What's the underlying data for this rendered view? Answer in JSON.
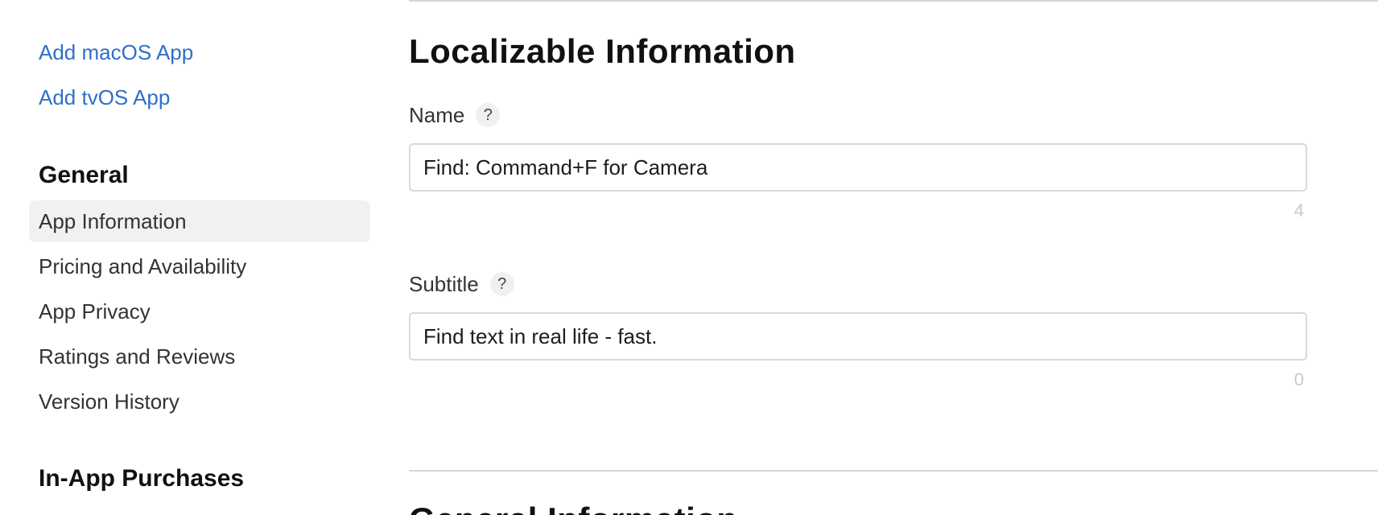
{
  "sidebar": {
    "links": {
      "add_macos": "Add macOS App",
      "add_tvos": "Add tvOS App"
    },
    "general_heading": "General",
    "items": [
      {
        "label": "App Information",
        "selected": true
      },
      {
        "label": "Pricing and Availability",
        "selected": false
      },
      {
        "label": "App Privacy",
        "selected": false
      },
      {
        "label": "Ratings and Reviews",
        "selected": false
      },
      {
        "label": "Version History",
        "selected": false
      }
    ],
    "iap_heading": "In-App Purchases"
  },
  "main": {
    "section_title": "Localizable Information",
    "name_field": {
      "label": "Name",
      "help": "?",
      "value": "Find: Command+F for Camera",
      "remaining": "4"
    },
    "subtitle_field": {
      "label": "Subtitle",
      "help": "?",
      "value": "Find text in real life - fast.",
      "remaining": "0"
    },
    "next_section_title": "General Information"
  },
  "colors": {
    "link": "#2f6fc7",
    "selected_bg": "#f1f1f1",
    "divider": "#d6d6d6",
    "counter": "#c9c9c9"
  }
}
